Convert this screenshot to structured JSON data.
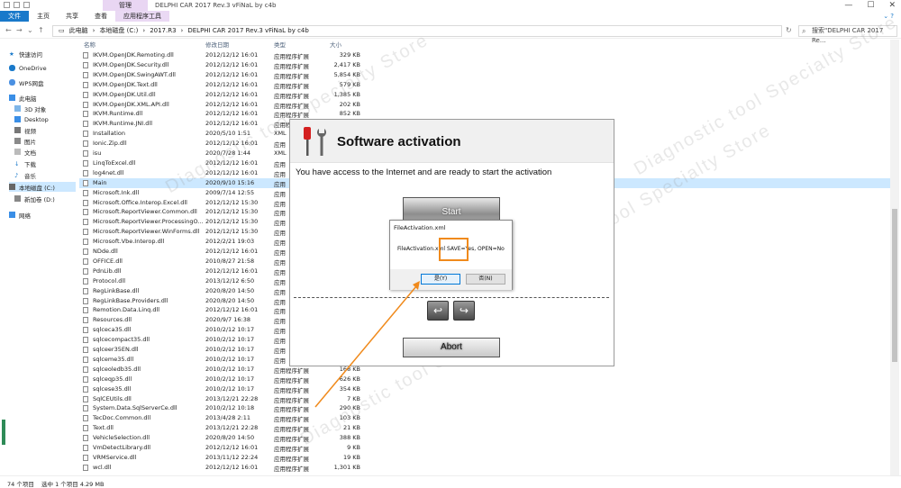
{
  "ribbon": {
    "tabs": [
      "文件",
      "主页",
      "共享",
      "查看",
      "应用程序工具"
    ],
    "manage_label": "管理",
    "window_title": "DELPHI CAR 2017  Rev.3 vFiNaL by c4b"
  },
  "address": {
    "crumbs": [
      "此电脑",
      "本地磁盘 (C:)",
      "2017.R3",
      "DELPHI CAR 2017  Rev.3 vFiNaL by c4b"
    ],
    "search_placeholder": "搜索\"DELPHI CAR 2017 Re..."
  },
  "nav": {
    "items": [
      {
        "label": "快速访问",
        "icon": "star-icon"
      },
      {
        "label": "OneDrive",
        "icon": "cloud-icon"
      },
      {
        "label": "WPS网盘",
        "icon": "cloud-icon"
      },
      {
        "label": "此电脑",
        "icon": "computer-icon"
      },
      {
        "label": "3D 对象",
        "icon": "cube-icon"
      },
      {
        "label": "Desktop",
        "icon": "desktop-icon"
      },
      {
        "label": "视频",
        "icon": "video-icon"
      },
      {
        "label": "图片",
        "icon": "picture-icon"
      },
      {
        "label": "文档",
        "icon": "document-icon"
      },
      {
        "label": "下载",
        "icon": "download-icon"
      },
      {
        "label": "音乐",
        "icon": "music-icon"
      },
      {
        "label": "本地磁盘 (C:)",
        "icon": "drive-icon"
      },
      {
        "label": "新加卷 (D:)",
        "icon": "drive-icon"
      },
      {
        "label": "网络",
        "icon": "network-icon"
      }
    ]
  },
  "list": {
    "headers": {
      "name": "名称",
      "date": "修改日期",
      "type": "类型",
      "size": "大小"
    },
    "rows": [
      {
        "name": "IKVM.OpenJDK.Remoting.dll",
        "date": "2012/12/12 16:01",
        "type": "应用程序扩展",
        "size": "329 KB"
      },
      {
        "name": "IKVM.OpenJDK.Security.dll",
        "date": "2012/12/12 16:01",
        "type": "应用程序扩展",
        "size": "2,417 KB"
      },
      {
        "name": "IKVM.OpenJDK.SwingAWT.dll",
        "date": "2012/12/12 16:01",
        "type": "应用程序扩展",
        "size": "5,854 KB"
      },
      {
        "name": "IKVM.OpenJDK.Text.dll",
        "date": "2012/12/12 16:01",
        "type": "应用程序扩展",
        "size": "579 KB"
      },
      {
        "name": "IKVM.OpenJDK.Util.dll",
        "date": "2012/12/12 16:01",
        "type": "应用程序扩展",
        "size": "1,385 KB"
      },
      {
        "name": "IKVM.OpenJDK.XML.API.dll",
        "date": "2012/12/12 16:01",
        "type": "应用程序扩展",
        "size": "202 KB"
      },
      {
        "name": "IKVM.Runtime.dll",
        "date": "2012/12/12 16:01",
        "type": "应用程序扩展",
        "size": "852 KB"
      },
      {
        "name": "IKVM.Runtime.JNI.dll",
        "date": "2012/12/12 16:01",
        "type": "应用程序扩展",
        "size": ""
      },
      {
        "name": "Installation",
        "date": "2020/5/10 1:51",
        "type": "XML",
        "size": ""
      },
      {
        "name": "Ionic.Zip.dll",
        "date": "2012/12/12 16:01",
        "type": "应用",
        "size": ""
      },
      {
        "name": "isu",
        "date": "2020/7/28 1:44",
        "type": "XML",
        "size": ""
      },
      {
        "name": "LinqToExcel.dll",
        "date": "2012/12/12 16:01",
        "type": "应用",
        "size": ""
      },
      {
        "name": "log4net.dll",
        "date": "2012/12/12 16:01",
        "type": "应用",
        "size": ""
      },
      {
        "name": "Main",
        "date": "2020/9/10 15:16",
        "type": "应用",
        "size": ""
      },
      {
        "name": "Microsoft.Ink.dll",
        "date": "2009/7/14 12:55",
        "type": "应用",
        "size": ""
      },
      {
        "name": "Microsoft.Office.Interop.Excel.dll",
        "date": "2012/12/12 15:30",
        "type": "应用",
        "size": ""
      },
      {
        "name": "Microsoft.ReportViewer.Common.dll",
        "date": "2012/12/12 15:30",
        "type": "应用",
        "size": ""
      },
      {
        "name": "Microsoft.ReportViewer.ProcessingO...",
        "date": "2012/12/12 15:30",
        "type": "应用",
        "size": ""
      },
      {
        "name": "Microsoft.ReportViewer.WinForms.dll",
        "date": "2012/12/12 15:30",
        "type": "应用",
        "size": ""
      },
      {
        "name": "Microsoft.Vbe.Interop.dll",
        "date": "2012/2/21 19:03",
        "type": "应用",
        "size": ""
      },
      {
        "name": "NDde.dll",
        "date": "2012/12/12 16:01",
        "type": "应用",
        "size": ""
      },
      {
        "name": "OFFICE.dll",
        "date": "2010/8/27 21:58",
        "type": "应用",
        "size": ""
      },
      {
        "name": "PdnLib.dll",
        "date": "2012/12/12 16:01",
        "type": "应用",
        "size": ""
      },
      {
        "name": "Protocol.dll",
        "date": "2013/12/12 6:50",
        "type": "应用",
        "size": ""
      },
      {
        "name": "RegLinkBase.dll",
        "date": "2020/8/20 14:50",
        "type": "应用",
        "size": ""
      },
      {
        "name": "RegLinkBase.Providers.dll",
        "date": "2020/8/20 14:50",
        "type": "应用",
        "size": ""
      },
      {
        "name": "Remotion.Data.Linq.dll",
        "date": "2012/12/12 16:01",
        "type": "应用",
        "size": ""
      },
      {
        "name": "Resources.dll",
        "date": "2020/9/7 16:38",
        "type": "应用",
        "size": ""
      },
      {
        "name": "sqlceca35.dll",
        "date": "2010/2/12 10:17",
        "type": "应用",
        "size": ""
      },
      {
        "name": "sqlcecompact35.dll",
        "date": "2010/2/12 10:17",
        "type": "应用",
        "size": ""
      },
      {
        "name": "sqlceer35EN.dll",
        "date": "2010/2/12 10:17",
        "type": "应用",
        "size": ""
      },
      {
        "name": "sqlceme35.dll",
        "date": "2010/2/12 10:17",
        "type": "应用",
        "size": ""
      },
      {
        "name": "sqlceoledb35.dll",
        "date": "2010/2/12 10:17",
        "type": "应用程序扩展",
        "size": "168 KB"
      },
      {
        "name": "sqlceqp35.dll",
        "date": "2010/2/12 10:17",
        "type": "应用程序扩展",
        "size": "626 KB"
      },
      {
        "name": "sqlcese35.dll",
        "date": "2010/2/12 10:17",
        "type": "应用程序扩展",
        "size": "354 KB"
      },
      {
        "name": "SqlCEUtils.dll",
        "date": "2013/12/21 22:28",
        "type": "应用程序扩展",
        "size": "7 KB"
      },
      {
        "name": "System.Data.SqlServerCe.dll",
        "date": "2010/2/12 10:18",
        "type": "应用程序扩展",
        "size": "290 KB"
      },
      {
        "name": "TecDoc.Common.dll",
        "date": "2013/4/28 2:11",
        "type": "应用程序扩展",
        "size": "103 KB"
      },
      {
        "name": "Text.dll",
        "date": "2013/12/21 22:28",
        "type": "应用程序扩展",
        "size": "21 KB"
      },
      {
        "name": "VehicleSelection.dll",
        "date": "2020/8/20 14:50",
        "type": "应用程序扩展",
        "size": "388 KB"
      },
      {
        "name": "VmDetectLibrary.dll",
        "date": "2012/12/12 16:01",
        "type": "应用程序扩展",
        "size": "9 KB"
      },
      {
        "name": "VRMService.dll",
        "date": "2013/11/12 22:24",
        "type": "应用程序扩展",
        "size": "19 KB"
      },
      {
        "name": "wcl.dll",
        "date": "2012/12/12 16:01",
        "type": "应用程序扩展",
        "size": "1,301 KB"
      }
    ]
  },
  "status": {
    "count": "74 个项目",
    "selected": "选中 1 个项目  4.29 MB"
  },
  "activation": {
    "title": "Software activation",
    "message": "You have access to the Internet and are ready to start the activation",
    "start_label": "Start",
    "abort_label": "Abort"
  },
  "msgbox": {
    "title": "FileActivation.xml",
    "text": "FileActivation.xml SAVE=Yes, OPEN=No",
    "yes_label": "是(Y)",
    "no_label": "否(N)"
  },
  "watermark_text": "Diagnostic tool Specialty Store",
  "colors": {
    "accent": "#1979ca",
    "selection": "#cce8ff",
    "highlight": "#f08a1c"
  }
}
